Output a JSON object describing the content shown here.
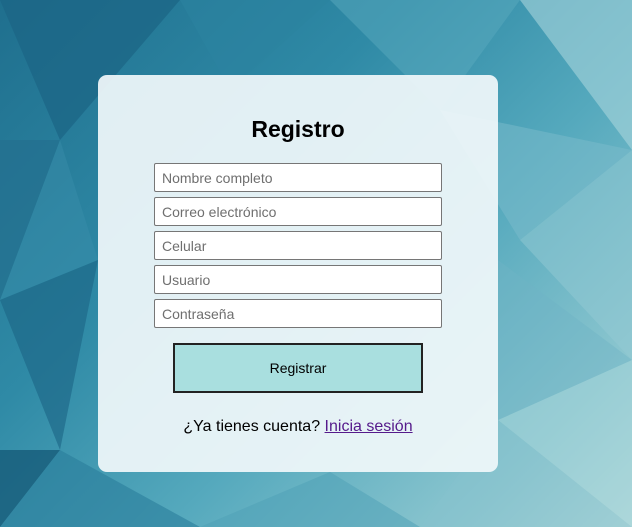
{
  "form": {
    "title": "Registro",
    "fields": [
      {
        "name": "fullname",
        "placeholder": "Nombre completo",
        "value": ""
      },
      {
        "name": "email",
        "placeholder": "Correo electrónico",
        "value": ""
      },
      {
        "name": "phone",
        "placeholder": "Celular",
        "value": ""
      },
      {
        "name": "username",
        "placeholder": "Usuario",
        "value": ""
      },
      {
        "name": "password",
        "placeholder": "Contraseña",
        "value": ""
      }
    ],
    "submit_label": "Registrar",
    "footer_prompt": "¿Ya tienes cuenta?",
    "login_link": "Inicia sesión"
  },
  "colors": {
    "button_bg": "#a9dfdf",
    "link": "#551a8b",
    "background_dark": "#1f6f8e",
    "background_light": "#b9dcdc"
  }
}
